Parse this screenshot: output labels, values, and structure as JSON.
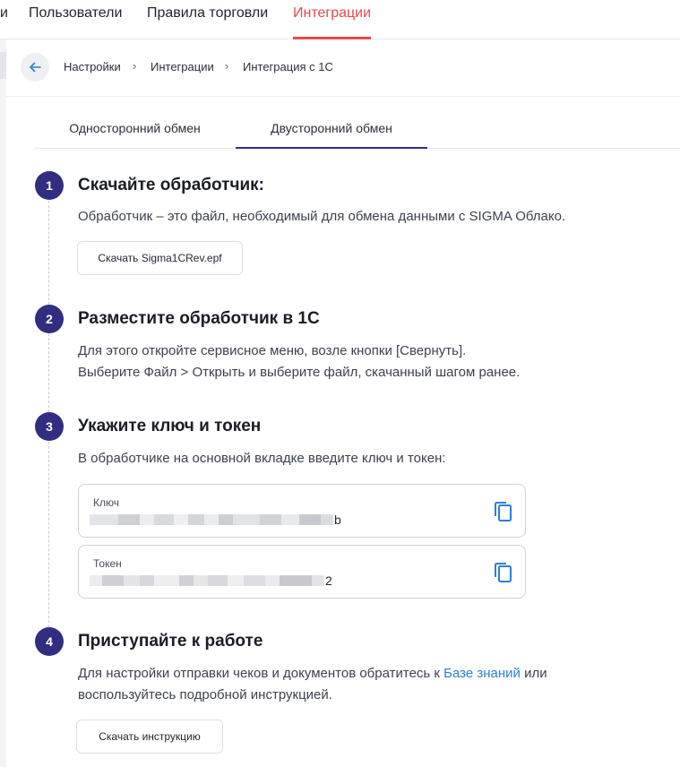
{
  "topnav": {
    "tabs": [
      {
        "label": "и",
        "active": false
      },
      {
        "label": "Пользователи",
        "active": false
      },
      {
        "label": "Правила торговли",
        "active": false
      },
      {
        "label": "Интеграции",
        "active": true
      }
    ]
  },
  "breadcrumb": {
    "items": [
      "Настройки",
      "Интеграции",
      "Интеграция с 1С"
    ],
    "separator": "›"
  },
  "exchange_tabs": {
    "one_way": "Односторонний обмен",
    "two_way": "Двусторонний обмен",
    "active": "two_way"
  },
  "steps": [
    {
      "number": "1",
      "title": "Скачайте обработчик:",
      "text": [
        "Обработчик – это файл, необходимый для обмена данными с SIGMA Облако."
      ],
      "button_label": "Скачать Sigma1CRev.epf"
    },
    {
      "number": "2",
      "title": "Разместите обработчик в 1С",
      "text": [
        "Для этого откройте сервисное меню, возле кнопки [Свернуть].",
        "Выберите Файл > Открыть и выберите файл, скачанный шагом ранее."
      ]
    },
    {
      "number": "3",
      "title": "Укажите ключ и токен",
      "text": [
        "В обработчике на основной вкладке введите ключ и токен:"
      ],
      "key_field": {
        "label": "Ключ",
        "value_visible_tail": "b"
      },
      "token_field": {
        "label": "Токен",
        "value_visible_tail": "2"
      }
    },
    {
      "number": "4",
      "title": "Приступайте к работе",
      "text_before_link": "Для настройки отправки чеков и документов обратитесь к ",
      "link_text": "Базе знаний",
      "text_after_link": " или",
      "text_line2": "воспользуйтесь подробной инструкцией.",
      "button_label": "Скачать инструкцию"
    }
  ],
  "colors": {
    "accent_red": "#e5484d",
    "step_badge": "#312e81",
    "link": "#2d7fd8",
    "copy_icon": "#2d7fd8"
  },
  "icons": {
    "back": "arrow-left-icon",
    "copy": "copy-icon"
  }
}
